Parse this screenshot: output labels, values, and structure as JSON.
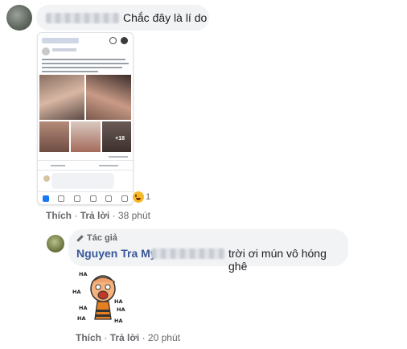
{
  "comment1": {
    "text": "Chắc đây là lí do",
    "reaction": {
      "emoji": "laughing-emoji-icon",
      "count": "1"
    },
    "actions": {
      "like": "Thích",
      "reply": "Trả lời",
      "time": "38 phút",
      "sep": "·"
    }
  },
  "comment2": {
    "author_badge": "Tác giả",
    "author": "Nguyen Tra My",
    "text": "trời ơi mún vô hóng ghê",
    "actions": {
      "like": "Thích",
      "reply": "Trả lời",
      "time": "20 phút",
      "sep": "·"
    }
  },
  "embedded_screenshot": {
    "more_photos": "+18"
  },
  "sticker": {
    "text": [
      "HA",
      "HA",
      "HA",
      "HA",
      "HA",
      "HA",
      "HA"
    ]
  },
  "colors": {
    "name_link": "#385898",
    "bubble": "#f2f3f5",
    "muted": "#65676b",
    "fb_blue": "#1877f2"
  }
}
